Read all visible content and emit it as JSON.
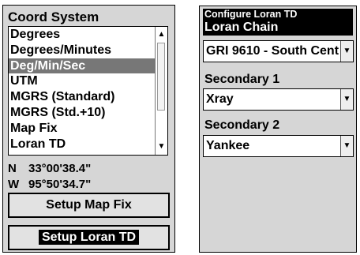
{
  "coord_panel": {
    "title": "Coord System",
    "options": [
      "Degrees",
      "Degrees/Minutes",
      "Deg/Min/Sec",
      "UTM",
      "MGRS (Standard)",
      "MGRS (Std.+10)",
      "Map Fix",
      "Loran TD"
    ],
    "selected_index": 2,
    "scroll_up": "▲",
    "scroll_down": "▼",
    "latitude": {
      "label": "N",
      "value": "33°00'38.4\""
    },
    "longitude": {
      "label": "W",
      "value": "95°50'34.7\""
    },
    "setup_map_fix_label": "Setup Map Fix",
    "setup_loran_label": "Setup Loran TD"
  },
  "loran_panel": {
    "title": "Configure Loran TD",
    "chain_label": "Loran Chain",
    "chain_value": "GRI 9610 - South Cent",
    "secondary1_label": "Secondary 1",
    "secondary1_value": "Xray",
    "secondary2_label": "Secondary 2",
    "secondary2_value": "Yankee",
    "dropdown_arrow": "▼"
  },
  "colors": {
    "panel_bg": "#d6d6d6",
    "selection_bg": "#777777",
    "header_bg": "#000000"
  }
}
